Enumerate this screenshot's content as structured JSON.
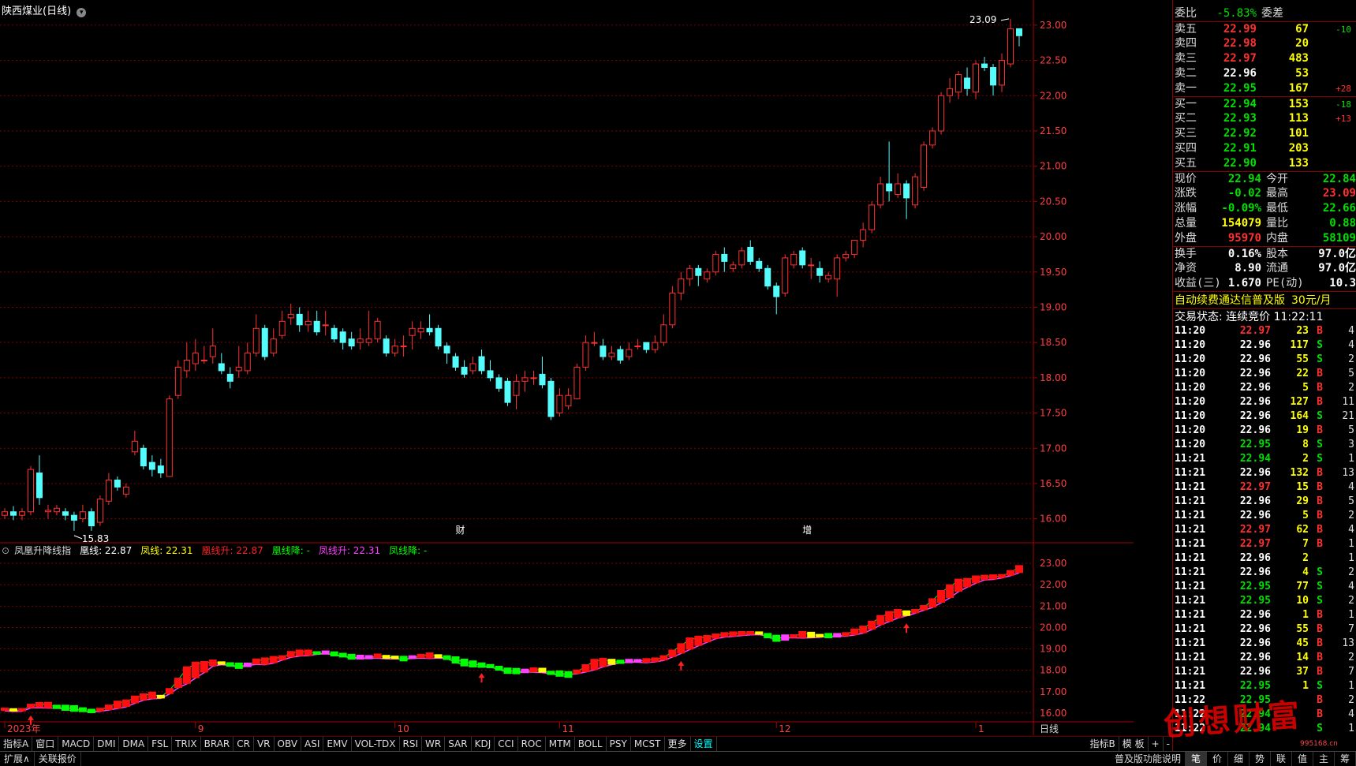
{
  "window": {
    "title": "陕西煤业(日线)"
  },
  "price_axis": [
    "23.00",
    "22.50",
    "22.00",
    "21.50",
    "21.00",
    "20.50",
    "20.00",
    "19.50",
    "19.00",
    "18.50",
    "18.00",
    "17.50",
    "17.00",
    "16.50",
    "16.00"
  ],
  "ind_axis": [
    "23.00",
    "22.00",
    "21.00",
    "20.00",
    "19.00",
    "18.00",
    "17.00",
    "16.00"
  ],
  "date_axis": [
    {
      "label": "2023年",
      "idx": 0
    },
    {
      "label": "9",
      "idx": 22
    },
    {
      "label": "10",
      "idx": 45
    },
    {
      "label": "11",
      "idx": 64
    },
    {
      "label": "12",
      "idx": 89
    },
    {
      "label": "1",
      "idx": 112
    }
  ],
  "axis_tail_label": "日线",
  "annotations": {
    "high_label": "23.09",
    "low_label": "15.83",
    "cai": "财",
    "zeng": "增"
  },
  "indicator": {
    "name": "凤凰升降线指",
    "items": [
      {
        "text": "凰线: 22.87",
        "color": "#ffffff"
      },
      {
        "text": "凤线: 22.31",
        "color": "#ffff00"
      },
      {
        "text": "凰线升: 22.87",
        "color": "#ff2020"
      },
      {
        "text": "凰线降: -",
        "color": "#00ff00"
      },
      {
        "text": "凤线升: 22.31",
        "color": "#ff40ff"
      },
      {
        "text": "凤线降: -",
        "color": "#00ff00"
      }
    ]
  },
  "tabs": [
    "指标A",
    "窗口",
    "MACD",
    "DMI",
    "DMA",
    "FSL",
    "TRIX",
    "BRAR",
    "CR",
    "VR",
    "OBV",
    "ASI",
    "EMV",
    "VOL-TDX",
    "RSI",
    "WR",
    "SAR",
    "KDJ",
    "CCI",
    "ROC",
    "MTM",
    "BOLL",
    "PSY",
    "MCST",
    "更多",
    "设置"
  ],
  "tabs_right": [
    "指标B",
    "模 板",
    "+",
    "-"
  ],
  "status_left": [
    "扩展∧",
    "关联报价"
  ],
  "status_mid": "普及版功能说明",
  "status_right": [
    "笔",
    "价",
    "细",
    "势",
    "联",
    "值",
    "主",
    "筹"
  ],
  "quote": {
    "weibi": {
      "label": "委比",
      "value": "-5.83%",
      "label2": "委差",
      "value2": ""
    },
    "sells": [
      {
        "label": "卖五",
        "price": "22.99",
        "vol": "67",
        "chg": "-10",
        "pc": "c-r",
        "cc": "c-g"
      },
      {
        "label": "卖四",
        "price": "22.98",
        "vol": "20",
        "chg": "",
        "pc": "c-r",
        "cc": "c-g"
      },
      {
        "label": "卖三",
        "price": "22.97",
        "vol": "483",
        "chg": "",
        "pc": "c-r",
        "cc": "c-g"
      },
      {
        "label": "卖二",
        "price": "22.96",
        "vol": "53",
        "chg": "",
        "pc": "c-w",
        "cc": "c-g"
      },
      {
        "label": "卖一",
        "price": "22.95",
        "vol": "167",
        "chg": "+28",
        "pc": "c-g",
        "cc": "c-r"
      }
    ],
    "buys": [
      {
        "label": "买一",
        "price": "22.94",
        "vol": "153",
        "chg": "-18",
        "pc": "c-g",
        "cc": "c-g"
      },
      {
        "label": "买二",
        "price": "22.93",
        "vol": "113",
        "chg": "+13",
        "pc": "c-g",
        "cc": "c-r"
      },
      {
        "label": "买三",
        "price": "22.92",
        "vol": "101",
        "chg": "",
        "pc": "c-g",
        "cc": "c-g"
      },
      {
        "label": "买四",
        "price": "22.91",
        "vol": "203",
        "chg": "",
        "pc": "c-g",
        "cc": "c-g"
      },
      {
        "label": "买五",
        "price": "22.90",
        "vol": "133",
        "chg": "",
        "pc": "c-g",
        "cc": "c-g"
      }
    ],
    "stats": [
      {
        "l1": "现价",
        "v1": "22.94",
        "c1": "c-g",
        "l2": "今开",
        "v2": "22.84",
        "c2": "c-g"
      },
      {
        "l1": "涨跌",
        "v1": "-0.02",
        "c1": "c-g",
        "l2": "最高",
        "v2": "23.09",
        "c2": "c-r"
      },
      {
        "l1": "涨幅",
        "v1": "-0.09%",
        "c1": "c-g",
        "l2": "最低",
        "v2": "22.66",
        "c2": "c-g"
      },
      {
        "l1": "总量",
        "v1": "154079",
        "c1": "c-y",
        "l2": "量比",
        "v2": "0.88",
        "c2": "c-g"
      },
      {
        "l1": "外盘",
        "v1": "95970",
        "c1": "c-r",
        "l2": "内盘",
        "v2": "58109",
        "c2": "c-g"
      }
    ],
    "stats2": [
      {
        "l1": "换手",
        "v1": "0.16%",
        "c1": "c-w",
        "l2": "股本",
        "v2": "97.0亿",
        "c2": "c-w"
      },
      {
        "l1": "净资",
        "v1": "8.90",
        "c1": "c-w",
        "l2": "流通",
        "v2": "97.0亿",
        "c2": "c-w"
      },
      {
        "l1": "收益(三)",
        "v1": "1.670",
        "c1": "c-w",
        "l2": "PE(动)",
        "v2": "10.3",
        "c2": "c-w"
      }
    ],
    "ad_text": "自动续费通达信普及版",
    "ad_price": "30元/月",
    "trade_status": "交易状态: 连续竞价 11:22:11"
  },
  "ticks": [
    {
      "t": "11:20",
      "p": "22.97",
      "v": "23",
      "d": "B",
      "n": "4"
    },
    {
      "t": "11:20",
      "p": "22.96",
      "v": "117",
      "d": "S",
      "n": "4"
    },
    {
      "t": "11:20",
      "p": "22.96",
      "v": "55",
      "d": "S",
      "n": "2"
    },
    {
      "t": "11:20",
      "p": "22.96",
      "v": "22",
      "d": "B",
      "n": "5"
    },
    {
      "t": "11:20",
      "p": "22.96",
      "v": "5",
      "d": "B",
      "n": "2"
    },
    {
      "t": "11:20",
      "p": "22.96",
      "v": "127",
      "d": "B",
      "n": "11"
    },
    {
      "t": "11:20",
      "p": "22.96",
      "v": "164",
      "d": "S",
      "n": "21"
    },
    {
      "t": "11:20",
      "p": "22.96",
      "v": "19",
      "d": "B",
      "n": "5"
    },
    {
      "t": "11:20",
      "p": "22.95",
      "v": "8",
      "d": "S",
      "n": "3"
    },
    {
      "t": "11:21",
      "p": "22.94",
      "v": "2",
      "d": "S",
      "n": "1"
    },
    {
      "t": "11:21",
      "p": "22.96",
      "v": "132",
      "d": "B",
      "n": "13"
    },
    {
      "t": "11:21",
      "p": "22.97",
      "v": "15",
      "d": "B",
      "n": "4"
    },
    {
      "t": "11:21",
      "p": "22.96",
      "v": "29",
      "d": "B",
      "n": "5"
    },
    {
      "t": "11:21",
      "p": "22.96",
      "v": "5",
      "d": "B",
      "n": "2"
    },
    {
      "t": "11:21",
      "p": "22.97",
      "v": "62",
      "d": "B",
      "n": "4"
    },
    {
      "t": "11:21",
      "p": "22.97",
      "v": "7",
      "d": "B",
      "n": "1"
    },
    {
      "t": "11:21",
      "p": "22.96",
      "v": "2",
      "d": "",
      "n": "1"
    },
    {
      "t": "11:21",
      "p": "22.96",
      "v": "4",
      "d": "S",
      "n": "2"
    },
    {
      "t": "11:21",
      "p": "22.95",
      "v": "77",
      "d": "S",
      "n": "4"
    },
    {
      "t": "11:21",
      "p": "22.95",
      "v": "10",
      "d": "S",
      "n": "2"
    },
    {
      "t": "11:21",
      "p": "22.96",
      "v": "1",
      "d": "B",
      "n": "1"
    },
    {
      "t": "11:21",
      "p": "22.96",
      "v": "55",
      "d": "B",
      "n": "7"
    },
    {
      "t": "11:21",
      "p": "22.96",
      "v": "45",
      "d": "B",
      "n": "13"
    },
    {
      "t": "11:21",
      "p": "22.96",
      "v": "14",
      "d": "B",
      "n": "2"
    },
    {
      "t": "11:21",
      "p": "22.96",
      "v": "37",
      "d": "B",
      "n": "7"
    },
    {
      "t": "11:21",
      "p": "22.95",
      "v": "1",
      "d": "S",
      "n": "1"
    },
    {
      "t": "11:22",
      "p": "22.95",
      "v": "",
      "d": "B",
      "n": "2"
    },
    {
      "t": "11:22",
      "p": "22.94",
      "v": "",
      "d": "B",
      "n": "4"
    },
    {
      "t": "11:22",
      "p": "22.94",
      "v": "",
      "d": "S",
      "n": "1"
    }
  ],
  "watermark": "创想财富",
  "watermark_url": "995168.cn",
  "colors": {
    "up": "#ff3030",
    "down": "#54fcfc",
    "grid": "#800000"
  },
  "chart_data": {
    "type": "candlestick",
    "ylim": [
      15.75,
      23.2
    ],
    "candles": [
      [
        16.05,
        16.1,
        16.0,
        16.15
      ],
      [
        16.1,
        16.05,
        15.98,
        16.18
      ],
      [
        16.05,
        16.1,
        15.98,
        16.15
      ],
      [
        16.1,
        16.7,
        16.05,
        16.75
      ],
      [
        16.65,
        16.3,
        16.2,
        16.9
      ],
      [
        16.1,
        16.12,
        16.0,
        16.2
      ],
      [
        16.1,
        16.15,
        16.05,
        16.2
      ],
      [
        16.1,
        16.05,
        15.98,
        16.15
      ],
      [
        16.05,
        15.98,
        15.83,
        16.1
      ],
      [
        16.0,
        16.1,
        15.95,
        16.2
      ],
      [
        16.1,
        15.9,
        15.83,
        16.15
      ],
      [
        15.95,
        16.28,
        15.9,
        16.33
      ],
      [
        16.25,
        16.55,
        16.2,
        16.65
      ],
      [
        16.55,
        16.45,
        16.4,
        16.6
      ],
      [
        16.35,
        16.45,
        16.3,
        16.5
      ],
      [
        16.95,
        17.1,
        16.9,
        17.25
      ],
      [
        17.0,
        16.75,
        16.7,
        17.05
      ],
      [
        16.8,
        16.7,
        16.6,
        16.9
      ],
      [
        16.75,
        16.65,
        16.58,
        16.85
      ],
      [
        16.6,
        17.7,
        16.6,
        17.75
      ],
      [
        17.75,
        18.15,
        17.7,
        18.25
      ],
      [
        18.1,
        18.25,
        18.0,
        18.5
      ],
      [
        18.2,
        18.35,
        18.1,
        18.55
      ],
      [
        18.25,
        18.25,
        18.2,
        18.45
      ],
      [
        18.3,
        18.45,
        18.2,
        18.7
      ],
      [
        18.2,
        18.1,
        18.05,
        18.35
      ],
      [
        18.05,
        17.95,
        17.85,
        18.15
      ],
      [
        18.1,
        18.15,
        18.0,
        18.45
      ],
      [
        18.1,
        18.35,
        18.05,
        18.5
      ],
      [
        18.35,
        18.7,
        18.3,
        18.9
      ],
      [
        18.7,
        18.3,
        18.25,
        18.75
      ],
      [
        18.35,
        18.55,
        18.3,
        18.7
      ],
      [
        18.6,
        18.8,
        18.55,
        18.95
      ],
      [
        18.85,
        18.9,
        18.75,
        19.05
      ],
      [
        18.9,
        18.75,
        18.65,
        19.0
      ],
      [
        18.75,
        18.8,
        18.65,
        18.95
      ],
      [
        18.8,
        18.65,
        18.6,
        18.95
      ],
      [
        18.75,
        18.75,
        18.6,
        18.95
      ],
      [
        18.7,
        18.55,
        18.5,
        18.75
      ],
      [
        18.65,
        18.5,
        18.4,
        18.7
      ],
      [
        18.55,
        18.45,
        18.4,
        18.65
      ],
      [
        18.5,
        18.55,
        18.4,
        18.7
      ],
      [
        18.5,
        18.55,
        18.45,
        18.95
      ],
      [
        18.55,
        18.8,
        18.5,
        18.85
      ],
      [
        18.55,
        18.35,
        18.3,
        18.6
      ],
      [
        18.35,
        18.45,
        18.3,
        18.55
      ],
      [
        18.45,
        18.45,
        18.3,
        18.6
      ],
      [
        18.6,
        18.7,
        18.4,
        18.8
      ],
      [
        18.65,
        18.7,
        18.55,
        18.8
      ],
      [
        18.7,
        18.65,
        18.6,
        18.9
      ],
      [
        18.7,
        18.45,
        18.4,
        18.75
      ],
      [
        18.45,
        18.35,
        18.2,
        18.5
      ],
      [
        18.3,
        18.15,
        18.1,
        18.35
      ],
      [
        18.15,
        18.05,
        18.0,
        18.25
      ],
      [
        18.1,
        18.2,
        18.05,
        18.3
      ],
      [
        18.3,
        18.1,
        18.05,
        18.4
      ],
      [
        18.1,
        18.0,
        17.95,
        18.25
      ],
      [
        18.0,
        17.85,
        17.8,
        18.05
      ],
      [
        17.95,
        17.65,
        17.6,
        18.0
      ],
      [
        17.75,
        17.95,
        17.55,
        18.05
      ],
      [
        17.95,
        18.0,
        17.8,
        18.1
      ],
      [
        18.0,
        18.0,
        17.9,
        18.1
      ],
      [
        18.05,
        17.9,
        17.85,
        18.3
      ],
      [
        17.95,
        17.45,
        17.4,
        18.0
      ],
      [
        17.5,
        17.75,
        17.45,
        17.85
      ],
      [
        17.6,
        17.75,
        17.55,
        17.85
      ],
      [
        17.7,
        18.15,
        17.7,
        18.2
      ],
      [
        18.15,
        18.5,
        18.1,
        18.6
      ],
      [
        18.5,
        18.5,
        18.45,
        18.65
      ],
      [
        18.45,
        18.3,
        18.25,
        18.55
      ],
      [
        18.3,
        18.35,
        18.25,
        18.45
      ],
      [
        18.4,
        18.25,
        18.2,
        18.45
      ],
      [
        18.3,
        18.4,
        18.25,
        18.5
      ],
      [
        18.45,
        18.45,
        18.4,
        18.55
      ],
      [
        18.5,
        18.4,
        18.35,
        18.5
      ],
      [
        18.4,
        18.5,
        18.35,
        18.6
      ],
      [
        18.5,
        18.75,
        18.45,
        18.9
      ],
      [
        18.75,
        19.2,
        18.7,
        19.3
      ],
      [
        19.2,
        19.4,
        19.1,
        19.5
      ],
      [
        19.4,
        19.55,
        19.3,
        19.6
      ],
      [
        19.55,
        19.45,
        19.3,
        19.6
      ],
      [
        19.4,
        19.5,
        19.35,
        19.55
      ],
      [
        19.5,
        19.75,
        19.45,
        19.8
      ],
      [
        19.75,
        19.65,
        19.5,
        19.85
      ],
      [
        19.55,
        19.6,
        19.5,
        19.65
      ],
      [
        19.6,
        19.8,
        19.55,
        19.85
      ],
      [
        19.85,
        19.65,
        19.6,
        19.95
      ],
      [
        19.65,
        19.55,
        19.5,
        19.7
      ],
      [
        19.55,
        19.3,
        19.25,
        19.6
      ],
      [
        19.3,
        19.15,
        18.9,
        19.35
      ],
      [
        19.2,
        19.7,
        19.15,
        19.75
      ],
      [
        19.6,
        19.75,
        19.55,
        19.8
      ],
      [
        19.8,
        19.6,
        19.55,
        19.85
      ],
      [
        19.6,
        19.6,
        19.4,
        19.7
      ],
      [
        19.55,
        19.45,
        19.35,
        19.65
      ],
      [
        19.4,
        19.45,
        19.35,
        19.5
      ],
      [
        19.4,
        19.7,
        19.15,
        19.75
      ],
      [
        19.7,
        19.75,
        19.65,
        19.8
      ],
      [
        19.75,
        19.95,
        19.7,
        19.95
      ],
      [
        19.95,
        20.1,
        19.85,
        20.2
      ],
      [
        20.1,
        20.45,
        20.05,
        20.5
      ],
      [
        20.45,
        20.75,
        20.4,
        20.85
      ],
      [
        20.75,
        20.65,
        20.5,
        21.35
      ],
      [
        20.6,
        20.75,
        20.55,
        20.9
      ],
      [
        20.75,
        20.55,
        20.25,
        20.8
      ],
      [
        20.45,
        20.85,
        20.4,
        20.9
      ],
      [
        20.7,
        21.3,
        20.65,
        21.35
      ],
      [
        21.3,
        21.5,
        21.25,
        21.55
      ],
      [
        21.5,
        22.0,
        21.45,
        22.05
      ],
      [
        22.0,
        22.1,
        21.9,
        22.25
      ],
      [
        22.05,
        22.3,
        21.95,
        22.35
      ],
      [
        22.25,
        22.1,
        22.0,
        22.4
      ],
      [
        22.05,
        22.45,
        21.95,
        22.5
      ],
      [
        22.45,
        22.4,
        22.35,
        22.55
      ],
      [
        22.4,
        22.15,
        22.0,
        22.45
      ],
      [
        22.15,
        22.5,
        22.05,
        22.6
      ],
      [
        22.45,
        22.95,
        22.4,
        23.09
      ],
      [
        22.95,
        22.85,
        22.7,
        22.95
      ]
    ]
  }
}
